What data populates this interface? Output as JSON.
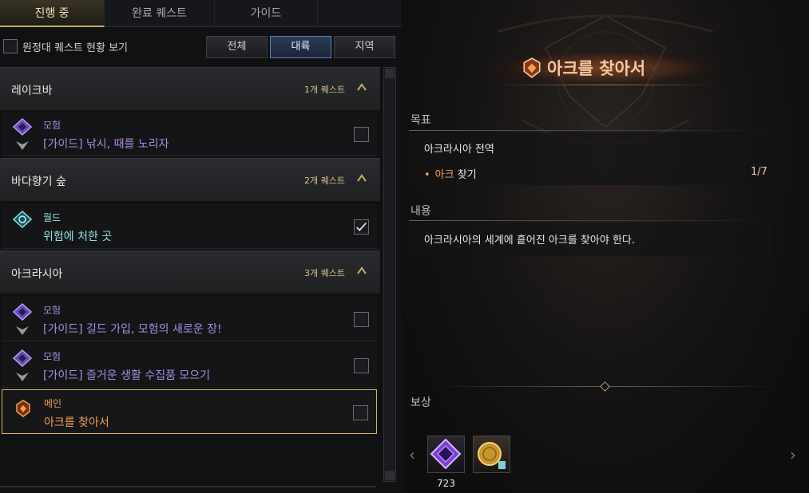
{
  "tabs": [
    "진행 중",
    "완료 퀘스트",
    "가이드"
  ],
  "expedition_label": "원정대 퀘스트 현황 보기",
  "filters": [
    "전체",
    "대륙",
    "지역"
  ],
  "groups": [
    {
      "name": "레이크바",
      "count": "1개 퀘스트"
    },
    {
      "name": "바다향기 숲",
      "count": "2개 퀘스트"
    },
    {
      "name": "아크라시아",
      "count": "3개 퀘스트"
    }
  ],
  "quests": [
    {
      "category": "모험",
      "title": "[가이드] 낚시, 때를 노리자"
    },
    {
      "category": "월드",
      "title": "위험에 처한 곳"
    },
    {
      "category": "모험",
      "title": "[가이드] 길드 가입, 모험의 새로운 장!"
    },
    {
      "category": "모험",
      "title": "[가이드] 즐거운 생활 수집품 모으기"
    },
    {
      "category": "메인",
      "title": "아크를 찾아서"
    }
  ],
  "detail": {
    "title": "아크를 찾아서",
    "objective_header": "목표",
    "objective_location": "아크라시아 전역",
    "objective_task_highlight": "아크",
    "objective_task_rest": "찾기",
    "objective_progress": "1/7",
    "content_header": "내용",
    "content_text": "아크라시아의 세계에 흩어진 아크를 찾아야 한다.",
    "reward_header": "보상",
    "reward_count": "723"
  },
  "colors": {
    "accent_gold": "#d9b65a",
    "adventure_purple": "#a98be0",
    "world_cyan": "#8ee3e4",
    "main_orange": "#f0a053",
    "active_filter": "#5f82b3"
  }
}
